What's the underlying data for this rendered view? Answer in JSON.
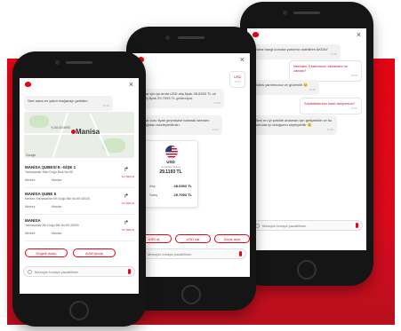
{
  "left_phone": {
    "greeting": "Size sana en yakın mağazayı getirdim",
    "greeting_time": "14:25",
    "map": {
      "city": "Manisa",
      "district": "YUNUSEMRE",
      "google": "Google"
    },
    "branches": [
      {
        "name": "MANİSA ŞUBESİ E -GİŞE 1",
        "address": "Yarhasanlar Mah Doğu Blok No:55",
        "city": "Merkez",
        "district": "Manisa",
        "direction": "Yol Tarifi Al"
      },
      {
        "name": "MANİSA ŞUBE 5",
        "address": "Merkez Yarhasanlar Mh Doğu Blk No:55 45030",
        "city": "Merkez",
        "district": "Manisa",
        "direction": "Yol Tarifi Al"
      },
      {
        "name": "MANİSA",
        "address": "Yarhasanlar Mh Doğu Blk No:55 45030",
        "city": "Merkez",
        "district": "Manisa",
        "direction": "Yol Tarifi Al"
      }
    ],
    "chips": [
      "Engelli dostu",
      "AVM içinde"
    ],
    "input_placeholder": "Mesajını buraya yazabilirsin"
  },
  "middle_phone": {
    "user_msg": "USD",
    "user_time": "14:31",
    "bot_msg1": "Dolar için şu anda USD alış fiyatı 28.6393 TL ve satış fiyatı 29.7093 TL görünüyor.",
    "bot_time1": "14:31",
    "bot_msg2": "Dolar kuru fiyatı geçmişine bakmak istersen aşağıdan inceleyebilirsin.",
    "bot_time2": "14:31",
    "fx": {
      "code": "USD",
      "name": "Amerikan Doları",
      "main_value": "29.1193 TL",
      "buy_label": "Alış",
      "buy_value": "28.6393 TL",
      "sell_label": "Satış",
      "sell_value": "29.7093 TL"
    },
    "chips": [
      "USD al",
      "USD sat",
      "Döviz alım"
    ],
    "input_placeholder": "Mesajını buraya yazabilirsin"
  },
  "right_phone": {
    "bot_greeting": "Sana hangi konuda yardımcı olabilirim AKDAY",
    "bot_greeting_time": "14:25",
    "user_msg1": "Nereden 3 kartımızın ekstresini ne zaman?",
    "user_time1": "14:28",
    "bot_msg1": "Bahis yardımcısız ve güvenilir 😊",
    "bot_time1": "14:28",
    "user_msg2": "Söylediklerinin nasıl anlıyorsun?",
    "user_time2": "14:29",
    "bot_msg2": "Beni en iyi şekilde anlaman için gelişebilim ve bu konuda iyi olduğumu söyleyebilir 😊",
    "bot_time2": "14:29",
    "input_placeholder": "Mesajını buraya yazabilirsin"
  }
}
